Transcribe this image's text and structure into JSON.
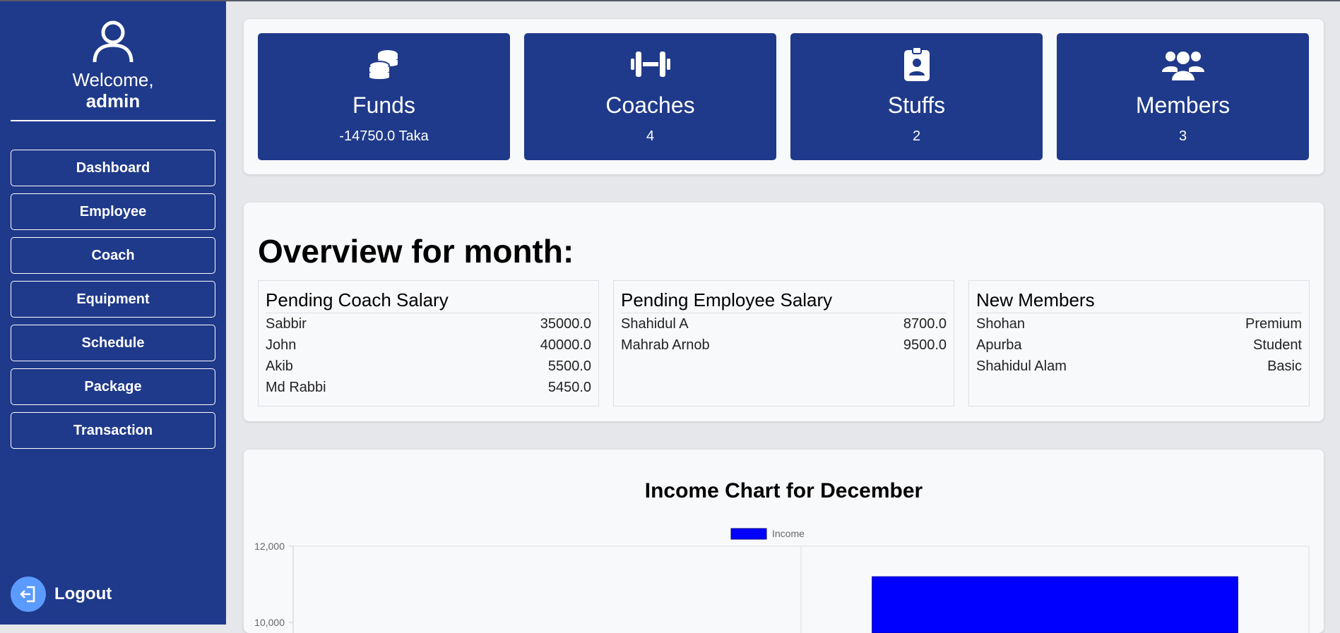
{
  "sidebar": {
    "welcome": "Welcome,",
    "username": "admin",
    "items": [
      {
        "label": "Dashboard"
      },
      {
        "label": "Employee"
      },
      {
        "label": "Coach"
      },
      {
        "label": "Equipment"
      },
      {
        "label": "Schedule"
      },
      {
        "label": "Package"
      },
      {
        "label": "Transaction"
      }
    ],
    "logout": "Logout"
  },
  "stats": [
    {
      "icon": "coins-icon",
      "title": "Funds",
      "value": "-14750.0 Taka"
    },
    {
      "icon": "dumbbell-icon",
      "title": "Coaches",
      "value": "4"
    },
    {
      "icon": "id-badge-icon",
      "title": "Stuffs",
      "value": "2"
    },
    {
      "icon": "users-icon",
      "title": "Members",
      "value": "3"
    }
  ],
  "overview": {
    "title": "Overview for month:",
    "coach_salary": {
      "title": "Pending Coach Salary",
      "rows": [
        {
          "name": "Sabbir",
          "value": "35000.0"
        },
        {
          "name": "John",
          "value": "40000.0"
        },
        {
          "name": "Akib",
          "value": "5500.0"
        },
        {
          "name": "Md Rabbi",
          "value": "5450.0"
        }
      ]
    },
    "employee_salary": {
      "title": "Pending Employee Salary",
      "rows": [
        {
          "name": "Shahidul A",
          "value": "8700.0"
        },
        {
          "name": "Mahrab Arnob",
          "value": "9500.0"
        }
      ]
    },
    "new_members": {
      "title": "New Members",
      "rows": [
        {
          "name": "Shohan",
          "value": "Premium"
        },
        {
          "name": "Apurba",
          "value": "Student"
        },
        {
          "name": "Shahidul Alam",
          "value": "Basic"
        }
      ]
    }
  },
  "colors": {
    "sidebar": "#1f3a8a",
    "card": "#1f3a8a",
    "bar": "#0000ff",
    "logout_circle": "#5b9bff"
  },
  "chart_data": {
    "type": "bar",
    "title": "Income Chart for December",
    "categories": [
      "",
      ""
    ],
    "series": [
      {
        "name": "Income",
        "values": [
          null,
          11200
        ]
      }
    ],
    "ylim": [
      0,
      12000
    ],
    "yticks": [
      "12,000",
      "10,000"
    ],
    "legend": "top",
    "grid": true
  }
}
